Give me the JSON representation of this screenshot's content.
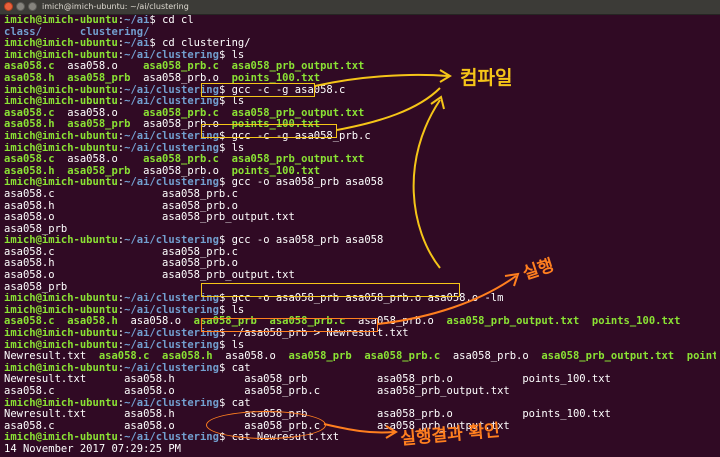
{
  "window": {
    "title": "imich@imich-ubuntu: ~/ai/clustering",
    "buttons": [
      "close",
      "minimize",
      "maximize"
    ]
  },
  "colors": {
    "background": "#300a24",
    "prompt_user": "#8ae234",
    "prompt_path": "#729fcf",
    "executable": "#8ae234",
    "text": "#ffffff",
    "highlight_box": "#f5c518",
    "annotation_yellow": "#f5c518",
    "annotation_orange": "#ff7f1f"
  },
  "terminal": {
    "lines": [
      [
        {
          "t": "imich@imich-ubuntu",
          "c": "uh"
        },
        {
          "t": ":",
          "c": "wt"
        },
        {
          "t": "~/ai",
          "c": "pt"
        },
        {
          "t": "$ cd cl",
          "c": "wt"
        }
      ],
      [
        {
          "t": "class/      clustering/",
          "c": "pt"
        }
      ],
      [
        {
          "t": "imich@imich-ubuntu",
          "c": "uh"
        },
        {
          "t": ":",
          "c": "wt"
        },
        {
          "t": "~/ai",
          "c": "pt"
        },
        {
          "t": "$ cd clustering/",
          "c": "wt"
        }
      ],
      [
        {
          "t": "imich@imich-ubuntu",
          "c": "uh"
        },
        {
          "t": ":",
          "c": "wt"
        },
        {
          "t": "~/ai/clustering",
          "c": "pt"
        },
        {
          "t": "$ ls",
          "c": "wt"
        }
      ],
      [
        {
          "t": "asa058.c",
          "c": "ex"
        },
        {
          "t": "  asa058.o    ",
          "c": "wt"
        },
        {
          "t": "asa058_prb.c  asa058_prb_output.txt",
          "c": "ex"
        }
      ],
      [
        {
          "t": "asa058.h",
          "c": "ex"
        },
        {
          "t": "  ",
          "c": "wt"
        },
        {
          "t": "asa058_prb",
          "c": "ex"
        },
        {
          "t": "  asa058_prb.o  ",
          "c": "wt"
        },
        {
          "t": "points_100.txt",
          "c": "ex"
        }
      ],
      [
        {
          "t": "imich@imich-ubuntu",
          "c": "uh"
        },
        {
          "t": ":",
          "c": "wt"
        },
        {
          "t": "~/ai/clustering",
          "c": "pt"
        },
        {
          "t": "$ gcc -c -g asa058.c",
          "c": "wt"
        }
      ],
      [
        {
          "t": "imich@imich-ubuntu",
          "c": "uh"
        },
        {
          "t": ":",
          "c": "wt"
        },
        {
          "t": "~/ai/clustering",
          "c": "pt"
        },
        {
          "t": "$ ls",
          "c": "wt"
        }
      ],
      [
        {
          "t": "asa058.c",
          "c": "ex"
        },
        {
          "t": "  asa058.o    ",
          "c": "wt"
        },
        {
          "t": "asa058_prb.c  asa058_prb_output.txt",
          "c": "ex"
        }
      ],
      [
        {
          "t": "asa058.h",
          "c": "ex"
        },
        {
          "t": "  ",
          "c": "wt"
        },
        {
          "t": "asa058_prb",
          "c": "ex"
        },
        {
          "t": "  asa058_prb.o  ",
          "c": "wt"
        },
        {
          "t": "points_100.txt",
          "c": "ex"
        }
      ],
      [
        {
          "t": "imich@imich-ubuntu",
          "c": "uh"
        },
        {
          "t": ":",
          "c": "wt"
        },
        {
          "t": "~/ai/clustering",
          "c": "pt"
        },
        {
          "t": "$ gcc -c -g asa058_prb.c",
          "c": "wt"
        }
      ],
      [
        {
          "t": "imich@imich-ubuntu",
          "c": "uh"
        },
        {
          "t": ":",
          "c": "wt"
        },
        {
          "t": "~/ai/clustering",
          "c": "pt"
        },
        {
          "t": "$ ls",
          "c": "wt"
        }
      ],
      [
        {
          "t": "asa058.c",
          "c": "ex"
        },
        {
          "t": "  asa058.o    ",
          "c": "wt"
        },
        {
          "t": "asa058_prb.c  asa058_prb_output.txt",
          "c": "ex"
        }
      ],
      [
        {
          "t": "asa058.h",
          "c": "ex"
        },
        {
          "t": "  ",
          "c": "wt"
        },
        {
          "t": "asa058_prb",
          "c": "ex"
        },
        {
          "t": "  asa058_prb.o  ",
          "c": "wt"
        },
        {
          "t": "points_100.txt",
          "c": "ex"
        }
      ],
      [
        {
          "t": "imich@imich-ubuntu",
          "c": "uh"
        },
        {
          "t": ":",
          "c": "wt"
        },
        {
          "t": "~/ai/clustering",
          "c": "pt"
        },
        {
          "t": "$ gcc -o asa058_prb asa058",
          "c": "wt"
        }
      ],
      [
        {
          "t": "asa058.c                 asa058_prb.c",
          "c": "wt"
        }
      ],
      [
        {
          "t": "asa058.h                 asa058_prb.o",
          "c": "wt"
        }
      ],
      [
        {
          "t": "asa058.o                 asa058_prb_output.txt",
          "c": "wt"
        }
      ],
      [
        {
          "t": "asa058_prb",
          "c": "wt"
        }
      ],
      [
        {
          "t": "imich@imich-ubuntu",
          "c": "uh"
        },
        {
          "t": ":",
          "c": "wt"
        },
        {
          "t": "~/ai/clustering",
          "c": "pt"
        },
        {
          "t": "$ gcc -o asa058_prb asa058",
          "c": "wt"
        }
      ],
      [
        {
          "t": "asa058.c                 asa058_prb.c",
          "c": "wt"
        }
      ],
      [
        {
          "t": "asa058.h                 asa058_prb.o",
          "c": "wt"
        }
      ],
      [
        {
          "t": "asa058.o                 asa058_prb_output.txt",
          "c": "wt"
        }
      ],
      [
        {
          "t": "asa058_prb",
          "c": "wt"
        }
      ],
      [
        {
          "t": "imich@imich-ubuntu",
          "c": "uh"
        },
        {
          "t": ":",
          "c": "wt"
        },
        {
          "t": "~/ai/clustering",
          "c": "pt"
        },
        {
          "t": "$ gcc -o asa058_prb asa058_prb.o asa058.o -lm",
          "c": "wt"
        }
      ],
      [
        {
          "t": "imich@imich-ubuntu",
          "c": "uh"
        },
        {
          "t": ":",
          "c": "wt"
        },
        {
          "t": "~/ai/clustering",
          "c": "pt"
        },
        {
          "t": "$ ls",
          "c": "wt"
        }
      ],
      [
        {
          "t": "asa058.c  asa058.h",
          "c": "ex"
        },
        {
          "t": "  asa058.o  ",
          "c": "wt"
        },
        {
          "t": "asa058_prb  asa058_prb.c",
          "c": "ex"
        },
        {
          "t": "  asa058_prb.o  ",
          "c": "wt"
        },
        {
          "t": "asa058_prb_output.txt  points_100.txt",
          "c": "ex"
        }
      ],
      [
        {
          "t": "imich@imich-ubuntu",
          "c": "uh"
        },
        {
          "t": ":",
          "c": "wt"
        },
        {
          "t": "~/ai/clustering",
          "c": "pt"
        },
        {
          "t": "$ ./asa058_prb > Newresult.txt",
          "c": "wt"
        }
      ],
      [
        {
          "t": "imich@imich-ubuntu",
          "c": "uh"
        },
        {
          "t": ":",
          "c": "wt"
        },
        {
          "t": "~/ai/clustering",
          "c": "pt"
        },
        {
          "t": "$ ls",
          "c": "wt"
        }
      ],
      [
        {
          "t": "Newresult.txt  ",
          "c": "wt"
        },
        {
          "t": "asa058.c  asa058.h",
          "c": "ex"
        },
        {
          "t": "  asa058.o  ",
          "c": "wt"
        },
        {
          "t": "asa058_prb  asa058_prb.c",
          "c": "ex"
        },
        {
          "t": "  asa058_prb.o  ",
          "c": "wt"
        },
        {
          "t": "asa058_prb_output.txt  points_100.txt",
          "c": "ex"
        }
      ],
      [
        {
          "t": "imich@imich-ubuntu",
          "c": "uh"
        },
        {
          "t": ":",
          "c": "wt"
        },
        {
          "t": "~/ai/clustering",
          "c": "pt"
        },
        {
          "t": "$ cat",
          "c": "wt"
        }
      ],
      [
        {
          "t": "Newresult.txt      asa058.h           asa058_prb           asa058_prb.o           points_100.txt",
          "c": "wt"
        }
      ],
      [
        {
          "t": "asa058.c           asa058.o           asa058_prb.c         asa058_prb_output.txt",
          "c": "wt"
        }
      ],
      [
        {
          "t": "imich@imich-ubuntu",
          "c": "uh"
        },
        {
          "t": ":",
          "c": "wt"
        },
        {
          "t": "~/ai/clustering",
          "c": "pt"
        },
        {
          "t": "$ cat",
          "c": "wt"
        }
      ],
      [
        {
          "t": "Newresult.txt      asa058.h           asa058_prb           asa058_prb.o           points_100.txt",
          "c": "wt"
        }
      ],
      [
        {
          "t": "asa058.c           asa058.o           asa058_prb.c         asa058_prb_output.txt",
          "c": "wt"
        }
      ],
      [
        {
          "t": "imich@imich-ubuntu",
          "c": "uh"
        },
        {
          "t": ":",
          "c": "wt"
        },
        {
          "t": "~/ai/clustering",
          "c": "pt"
        },
        {
          "t": "$ cat Newresult.txt",
          "c": "wt"
        }
      ],
      [
        {
          "t": "14 November 2017 07:29:25 PM",
          "c": "wt"
        }
      ]
    ]
  },
  "annotations": {
    "compile_note": "컴파일",
    "run_note": "실행",
    "check_note": "실행결과 확인"
  }
}
